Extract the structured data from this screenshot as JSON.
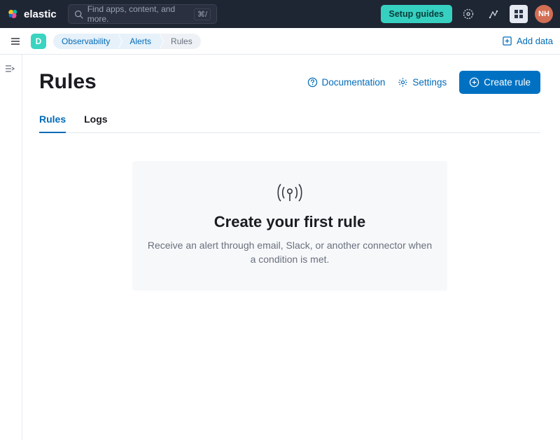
{
  "topbar": {
    "brand": "elastic",
    "search_placeholder": "Find apps, content, and more.",
    "kbd_hint": "⌘/",
    "setup_guides_label": "Setup guides",
    "avatar_initials": "NH"
  },
  "subbar": {
    "space_initial": "D",
    "breadcrumbs": [
      "Observability",
      "Alerts",
      "Rules"
    ],
    "add_data_label": "Add data"
  },
  "page": {
    "title": "Rules",
    "actions": {
      "documentation": "Documentation",
      "settings": "Settings",
      "create_rule": "Create rule"
    },
    "tabs": [
      {
        "label": "Rules",
        "active": true
      },
      {
        "label": "Logs",
        "active": false
      }
    ],
    "empty": {
      "title": "Create your first rule",
      "description": "Receive an alert through email, Slack, or another connector when a condition is met."
    }
  }
}
